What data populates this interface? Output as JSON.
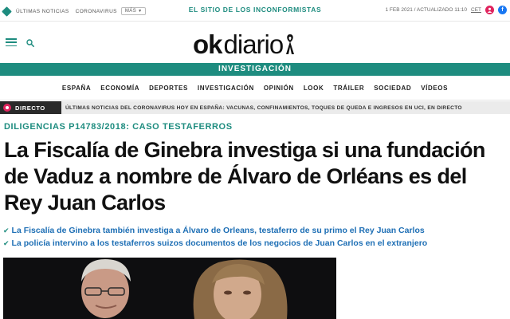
{
  "topbar": {
    "links": [
      "ÚLTIMAS NOTICIAS",
      "CORONAVIRUS"
    ],
    "more_label": "MÁS",
    "tagline": "EL SITIO DE LOS INCONFORMISTAS",
    "date": "1 FEB 2021 / ACTUALIZADO 11:10",
    "timezone": "CET"
  },
  "header": {
    "logo_ok": "ok",
    "logo_diario": "diario"
  },
  "section_banner": "INVESTIGACIÓN",
  "nav": {
    "items": [
      "ESPAÑA",
      "ECONOMÍA",
      "DEPORTES",
      "INVESTIGACIÓN",
      "OPINIÓN",
      "LOOK",
      "TRÁILER",
      "SOCIEDAD",
      "VÍDEOS"
    ]
  },
  "directo": {
    "label": "DIRECTO",
    "headline": "ÚLTIMAS NOTICIAS DEL CORONAVIRUS HOY EN ESPAÑA: VACUNAS, CONFINAMIENTOS, TOQUES DE QUEDA E INGRESOS EN UCI, EN DIRECTO"
  },
  "article": {
    "kicker": "DILIGENCIAS P14783/2018: CASO TESTAFERROS",
    "title": "La Fiscalía de Ginebra investiga si una fundación de Vaduz a nombre de Álvaro de Orléans es del Rey Juan Carlos",
    "related": [
      "La Fiscalía de Ginebra también investiga a Álvaro de Orleans, testaferro de su primo el Rey Juan Carlos",
      "La policía intervino a los testaferros suizos documentos de los negocios de Juan Carlos en el extranjero"
    ]
  },
  "colors": {
    "brand": "#1e8c7f",
    "link": "#1e6fb5",
    "live": "#e0245e"
  }
}
